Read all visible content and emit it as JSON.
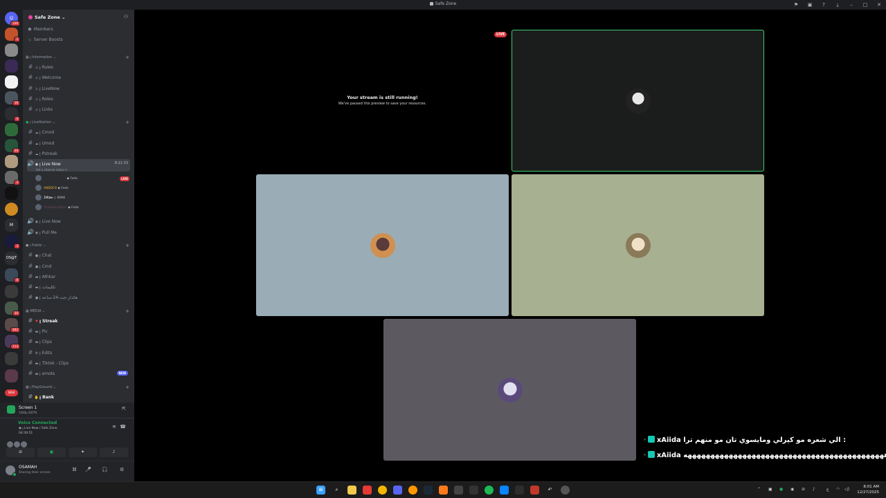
{
  "window": {
    "title": "Safe Zone"
  },
  "rail": {
    "badges": [
      "236",
      "2",
      "16",
      "4",
      "20",
      "3",
      "3",
      "8",
      "30",
      "642",
      "113",
      "NEW"
    ],
    "labels": {
      "os_abbrev": "OS@T"
    }
  },
  "server": {
    "name": "Safe Zone",
    "top_items": [
      {
        "label": "Members",
        "icon": "members-icon"
      },
      {
        "label": "Server Boosts",
        "icon": "boost-icon"
      }
    ]
  },
  "categories": {
    "information": "ꞁ Information",
    "livestation": "ꞁ LiveStation",
    "public": "ꞁ Public",
    "media": "MEDIA",
    "playground": "ꞁ PlayGround"
  },
  "channels": {
    "information": [
      "ꞁ Rules",
      "ꞁ Welcome",
      "ꞁ LiveNow",
      "ꞁ Roles",
      "ꞁ Links"
    ],
    "livestation": [
      "ꞁ Cmod",
      "ꞁ Umod",
      "ꞁ Pstreak"
    ],
    "public": [
      "ꞁ Chat",
      "ꞁ Cmd",
      "ꞁ Athkar",
      "ꞁ تكليمات",
      "ꞁ هكذار-جت-24-ساعه"
    ],
    "media": [
      "ꞁ Streak",
      "ꞁ Pic",
      "ꞁ Clips",
      "ꞁ Edits",
      "ꞁ Tiktok - Clips",
      "ꞁ emots"
    ],
    "playground": [
      "ꞁ Bank"
    ]
  },
  "voice_channel": {
    "name": "ꞁ Live Now",
    "timer": "8:21:33",
    "status_hint": "Set a channel status",
    "users": [
      {
        "name": "",
        "tag": "Fade",
        "live": "LIVE"
      },
      {
        "name": "A8DDC9",
        "tag": "Fade"
      },
      {
        "name": "ᗪ𝕶𝕴𝖊𝖊",
        "tag": "BMW"
      },
      {
        "name": "TheDawsyBear",
        "tag": "Fade"
      }
    ],
    "others": [
      "ꞁ Live Now",
      "ꞁ Pull Me"
    ]
  },
  "new_badge": "NEW",
  "voice_panel": {
    "screen_title": "Screen 1",
    "screen_sub": "1080p 60FPS",
    "status": "Voice Connected",
    "path": "ꞁ Live Now / Safe Zone",
    "elapsed": "04:39:51"
  },
  "user": {
    "name": "OSAMAH",
    "status": "Sharing their screen"
  },
  "stage": {
    "paused_title": "Your stream is still running!",
    "paused_sub": "We've paused this preview to save your resources.",
    "live_label": "LIVE"
  },
  "chat": [
    {
      "user": "xAiida",
      "message": "الي شعره مو كيرلي ومايسوي تان مو منهم ترا : "
    },
    {
      "user": "xAiida",
      "message": "ههههههههههههههههههههههههههههههههههههههههههههه : "
    }
  ],
  "clock": {
    "time": "8:01 AM",
    "date": "12/27/2025"
  },
  "colors": {
    "accent": "#5865f2",
    "live": "#da373c",
    "online": "#23a55a"
  }
}
